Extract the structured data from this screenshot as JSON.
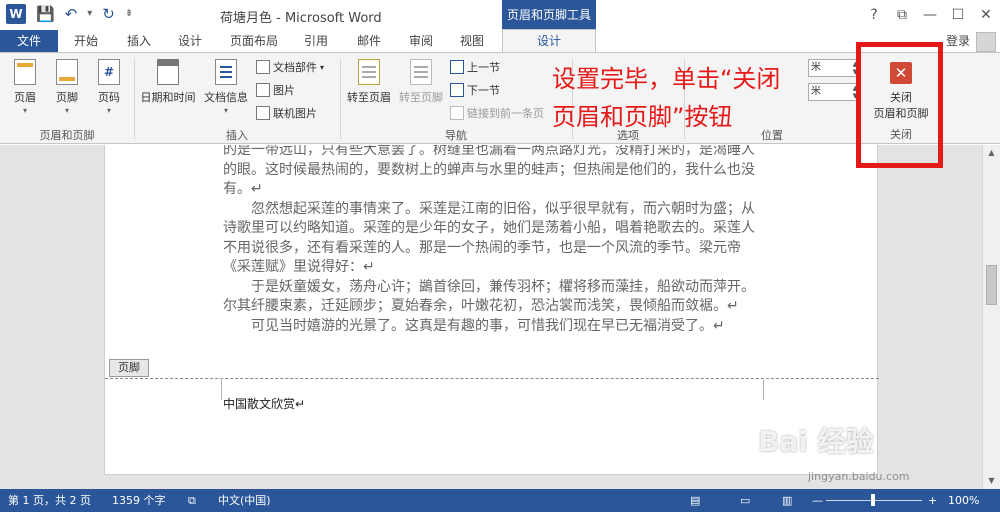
{
  "window": {
    "doc_title": "荷塘月色 - Microsoft Word",
    "context_tab_title": "页眉和页脚工具",
    "controls": [
      "?",
      "⧉",
      "—",
      "☐",
      "✕"
    ]
  },
  "qat": {
    "logo": "W",
    "save": "💾",
    "undo": "↶",
    "undo_caret": "▾",
    "redo": "↻",
    "customize": "⇟"
  },
  "tabs": {
    "file": "文件",
    "items": [
      "开始",
      "插入",
      "设计",
      "页面布局",
      "引用",
      "邮件",
      "审阅",
      "视图"
    ],
    "active": "设计",
    "signin": "登录"
  },
  "ribbon": {
    "group_header_footer": {
      "label": "页眉和页脚",
      "header": "页眉",
      "footer": "页脚",
      "page_number": "页码"
    },
    "group_insert": {
      "label": "插入",
      "date_time": "日期和时间",
      "doc_info": "文档信息",
      "quick_parts": "文档部件",
      "picture": "图片",
      "online_picture": "联机图片"
    },
    "group_navigation": {
      "label": "导航",
      "goto_header": "转至页眉",
      "goto_footer": "转至页脚",
      "previous": "上一节",
      "next": "下一节",
      "link_previous": "链接到前一条页"
    },
    "group_options": {
      "label": "选项"
    },
    "group_position": {
      "label": "位置",
      "field1": "米",
      "field2": "米"
    },
    "group_close": {
      "label": "关闭",
      "close_line1": "关闭",
      "close_line2": "页眉和页脚",
      "icon": "✕"
    }
  },
  "annotation": {
    "line1": "设置完毕，单击“关闭",
    "line2": "页眉和页脚”按钮"
  },
  "document": {
    "paragraphs": [
      {
        "text": "的是一带远山，只有些大意罢了。树缝里也漏着一两点路灯光，没精打采的，是渴睡人的眼。这时候最热闹的，要数树上的蝉声与水里的蛙声；但热闹是他们的，我什么也没有。↵",
        "indent": false
      },
      {
        "text": "忽然想起采莲的事情来了。采莲是江南的旧俗，似乎很早就有，而六朝时为盛；从诗歌里可以约略知道。采莲的是少年的女子，她们是荡着小船，唱着艳歌去的。采莲人不用说很多，还有看采莲的人。那是一个热闹的季节，也是一个风流的季节。梁元帝《采莲赋》里说得好：↵",
        "indent": true
      },
      {
        "text": "于是妖童媛女，荡舟心许；鷁首徐回，兼传羽杯；欋将移而藻挂，船欲动而萍开。尔其纤腰束素，迁延顾步；夏始春余，叶嫩花初，恐沾裳而浅笑，畏倾船而敛裾。↵",
        "indent": true
      },
      {
        "text": "可见当时嬉游的光景了。这真是有趣的事，可惜我们现在早已无福消受了。↵",
        "indent": true
      }
    ],
    "footer_tag": "页脚",
    "footer_text": "中国散文欣赏↵"
  },
  "statusbar": {
    "page": "第 1 页，共 2 页",
    "words": "1359 个字",
    "language": "中文(中国)",
    "zoom": "100%"
  },
  "watermark": {
    "main": "Bai 经验",
    "sub": "jingyan.baidu.com"
  }
}
